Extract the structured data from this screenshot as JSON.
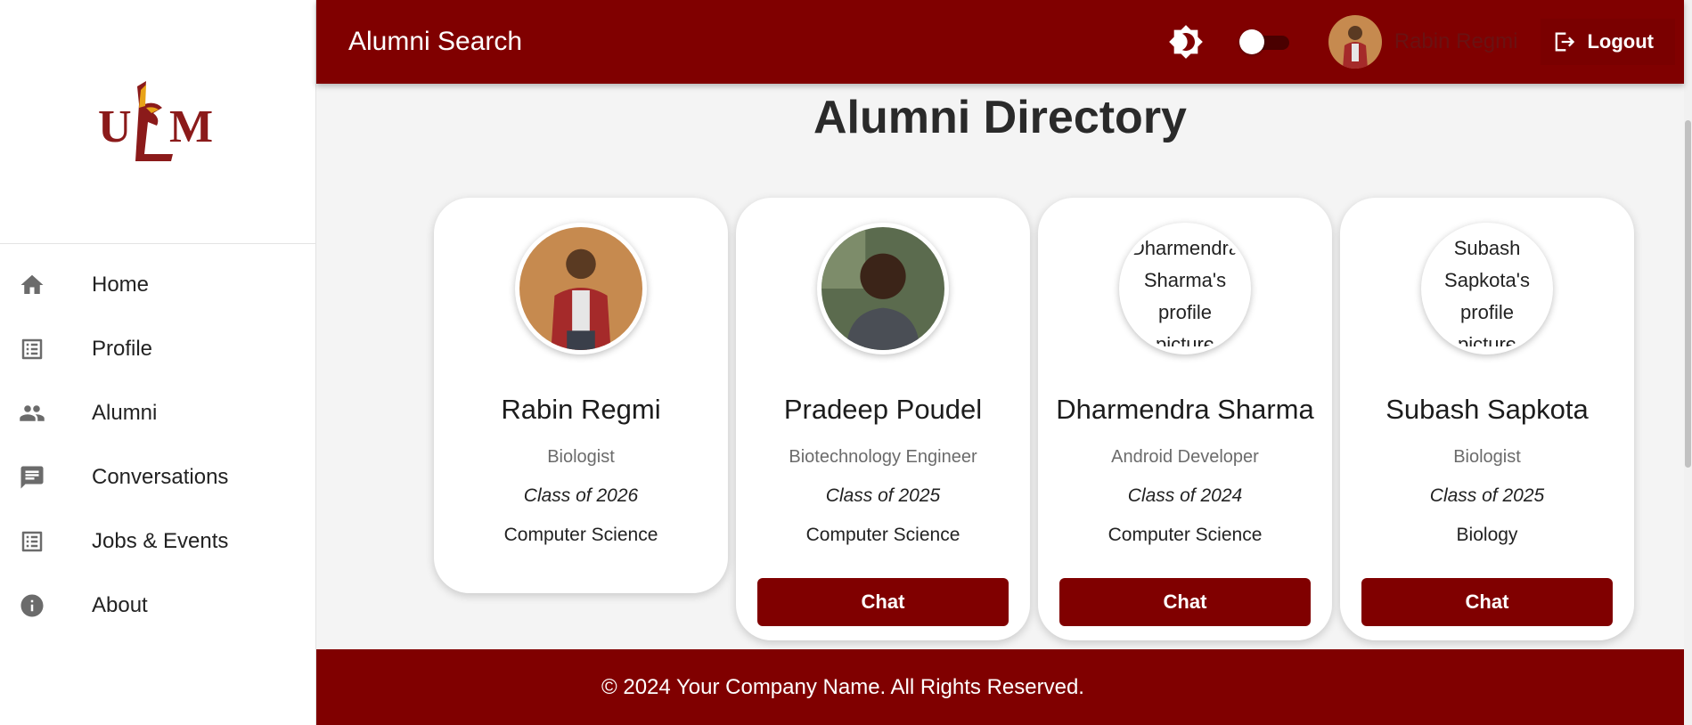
{
  "topbar": {
    "title": "Alumni Search",
    "username": "Rabin Regmi",
    "logout_label": "Logout",
    "brightness_icon": "brightness-icon",
    "theme_toggle_on": false
  },
  "sidebar": {
    "logo_text": "ULM",
    "items": [
      {
        "label": "Home",
        "icon": "home-icon"
      },
      {
        "label": "Profile",
        "icon": "list-icon"
      },
      {
        "label": "Alumni",
        "icon": "people-icon"
      },
      {
        "label": "Conversations",
        "icon": "chat-icon"
      },
      {
        "label": "Jobs & Events",
        "icon": "list-icon"
      },
      {
        "label": "About",
        "icon": "info-icon"
      }
    ]
  },
  "main": {
    "page_title": "Alumni Directory",
    "cards": [
      {
        "name": "Rabin Regmi",
        "role": "Biologist",
        "class": "Class of 2026",
        "major": "Computer Science",
        "has_chat": false
      },
      {
        "name": "Pradeep Poudel",
        "role": "Biotechnology Engineer",
        "class": "Class of 2025",
        "major": "Computer Science",
        "has_chat": true,
        "chat_label": "Chat"
      },
      {
        "name": "Dharmendra Sharma",
        "role": "Android Developer",
        "class": "Class of 2024",
        "major": "Computer Science",
        "has_chat": true,
        "chat_label": "Chat",
        "avatar_alt": "Dharmendra Sharma's profile picture"
      },
      {
        "name": "Subash Sapkota",
        "role": "Biologist",
        "class": "Class of 2025",
        "major": "Biology",
        "has_chat": true,
        "chat_label": "Chat",
        "avatar_alt": "Subash Sapkota's profile picture"
      }
    ]
  },
  "footer": {
    "text": "© 2024 Your Company Name. All Rights Reserved."
  },
  "colors": {
    "brand": "#800000",
    "page_bg": "#f4f4f4",
    "logo_gold": "#e8a317"
  }
}
